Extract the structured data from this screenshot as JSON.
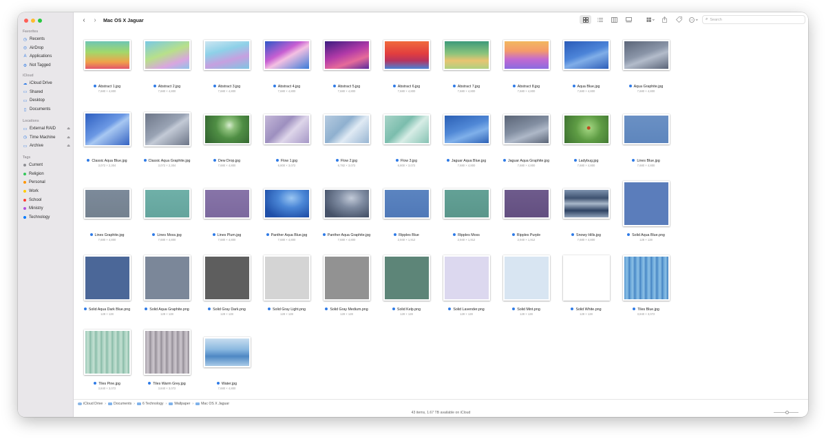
{
  "window": {
    "title": "Mac OS X Jaguar"
  },
  "toolbar": {
    "back_icon": "chevron-left-icon",
    "forward_icon": "chevron-right-icon",
    "view_buttons": [
      "icon-view",
      "list-view",
      "column-view",
      "gallery-view"
    ],
    "group_icon": "group-by-icon",
    "share_icon": "share-icon",
    "tag_icon": "tag-icon",
    "more_icon": "ellipsis-circle-icon",
    "search_placeholder": "Search"
  },
  "sidebar": {
    "sections": [
      {
        "heading": "Favorites",
        "items": [
          {
            "label": "Recents",
            "icon": "clock-icon"
          },
          {
            "label": "AirDrop",
            "icon": "airdrop-icon"
          },
          {
            "label": "Applications",
            "icon": "applications-icon"
          },
          {
            "label": "Not Tagged",
            "icon": "gear-icon"
          }
        ]
      },
      {
        "heading": "iCloud",
        "items": [
          {
            "label": "iCloud Drive",
            "icon": "cloud-icon"
          },
          {
            "label": "Shared",
            "icon": "shared-folder-icon"
          },
          {
            "label": "Desktop",
            "icon": "desktop-icon"
          },
          {
            "label": "Documents",
            "icon": "document-icon"
          }
        ]
      },
      {
        "heading": "Locations",
        "items": [
          {
            "label": "External RAID",
            "icon": "drive-icon",
            "eject": true
          },
          {
            "label": "Time Machine",
            "icon": "time-machine-icon",
            "eject": true
          },
          {
            "label": "Archive",
            "icon": "drive-icon",
            "eject": true
          }
        ]
      },
      {
        "heading": "Tags",
        "items": [
          {
            "label": "Current",
            "color": "#8e8e93"
          },
          {
            "label": "Religion",
            "color": "#34c759"
          },
          {
            "label": "Personal",
            "color": "#ff9500"
          },
          {
            "label": "Work",
            "color": "#ffcc00"
          },
          {
            "label": "School",
            "color": "#ff3b30"
          },
          {
            "label": "Ministry",
            "color": "#af52de"
          },
          {
            "label": "Technology",
            "color": "#007aff"
          }
        ]
      }
    ]
  },
  "files": [
    {
      "name": "Abstract 1.jpg",
      "dims": "7,680 × 4,800",
      "shape": "wide",
      "fill": "linear-gradient(180deg,#6fc6b4 0%,#a3d86a 40%,#f0a24a 75%,#e2556a 100%)"
    },
    {
      "name": "Abstract 2.jpg",
      "dims": "7,680 × 4,800",
      "shape": "wide",
      "fill": "linear-gradient(160deg,#79c9e6 0%,#b8e08a 45%,#d9a6e0 75%,#8fc3e8 100%)"
    },
    {
      "name": "Abstract 3.jpg",
      "dims": "7,680 × 4,800",
      "shape": "wide",
      "fill": "linear-gradient(165deg,#cde6f2 0%,#8ed1e8 35%,#c6a0e0 65%,#7ec6e2 100%)"
    },
    {
      "name": "Abstract 4.jpg",
      "dims": "7,680 × 4,800",
      "shape": "wide",
      "fill": "linear-gradient(150deg,#2d56c8 0%,#c75fd2 40%,#f4c0e2 55%,#3a7bd8 100%)"
    },
    {
      "name": "Abstract 5.jpg",
      "dims": "7,680 × 4,800",
      "shape": "wide",
      "fill": "linear-gradient(160deg,#3b1c80 0%,#b23aa8 45%,#e66b9a 70%,#5a2a9c 100%)"
    },
    {
      "name": "Abstract 6.jpg",
      "dims": "7,680 × 4,800",
      "shape": "wide",
      "fill": "linear-gradient(180deg,#f06a3c 0%,#e23e3e 45%,#b8345e 70%,#4a82d4 100%)"
    },
    {
      "name": "Abstract 7.jpg",
      "dims": "7,680 × 4,800",
      "shape": "wide",
      "fill": "linear-gradient(180deg,#3c9a7a 0%,#8cc47c 45%,#e8c472 70%,#b0d080 100%)"
    },
    {
      "name": "Abstract 8.jpg",
      "dims": "7,680 × 4,800",
      "shape": "wide",
      "fill": "linear-gradient(180deg,#f2b860 0%,#f49a6a 35%,#c36ad0 65%,#8b6be0 100%)"
    },
    {
      "name": "Aqua Blue.jpg",
      "dims": "7,680 × 4,800",
      "shape": "wide",
      "fill": "linear-gradient(160deg,#2a5bb8 0%,#4c84d8 45%,#80aee8 60%,#2d5eb8 100%)"
    },
    {
      "name": "Aqua Graphite.jpg",
      "dims": "7,680 × 4,800",
      "shape": "wide",
      "fill": "linear-gradient(160deg,#5b6578 0%,#8a95a8 45%,#b3bccb 60%,#5a6478 100%)"
    },
    {
      "name": "Classic Aqua Blue.jpg",
      "dims": "3,072 × 2,304",
      "shape": "wide-tall",
      "fill": "linear-gradient(145deg,#2e5fc0 0%,#6b98e4 45%,#a8c8f2 55%,#3563c2 100%)"
    },
    {
      "name": "Classic Aqua Graphite.jpg",
      "dims": "3,072 × 2,304",
      "shape": "wide-tall",
      "fill": "linear-gradient(145deg,#6d7688 0%,#99a3b4 45%,#c3cad6 55%,#6c7587 100%)"
    },
    {
      "name": "Dew Drop.jpg",
      "dims": "7,680 × 4,800",
      "shape": "wide",
      "fill": "radial-gradient(circle at 55% 35%,#d8ecd0 0%,#8cbf7a 18%,#4f8e44 45%,#2f5f2e 100%)"
    },
    {
      "name": "Flow 1.jpg",
      "dims": "6,800 × 3,072",
      "shape": "wide",
      "fill": "linear-gradient(135deg,#c4b8d8 0%,#9d8fbf 40%,#ded6ea 60%,#a597c6 100%)"
    },
    {
      "name": "Flow 2.jpg",
      "dims": "6,782 × 3,072",
      "shape": "wide",
      "fill": "linear-gradient(135deg,#b6cbe0 0%,#8fb0cf 40%,#e0eaf4 60%,#98b5d2 100%)"
    },
    {
      "name": "Flow 3.jpg",
      "dims": "6,800 × 3,072",
      "shape": "wide",
      "fill": "linear-gradient(135deg,#a8d4c8 0%,#7bbdad 40%,#d7ede6 60%,#86c2b3 100%)"
    },
    {
      "name": "Jaguar Aqua Blue.jpg",
      "dims": "7,680 × 4,800",
      "shape": "wide",
      "fill": "linear-gradient(160deg,#2b5fb4 0%,#5088d6 45%,#7fb0ea 65%,#2e62b6 100%)"
    },
    {
      "name": "Jaguar Aqua Graphite.jpg",
      "dims": "7,680 × 4,800",
      "shape": "wide",
      "fill": "linear-gradient(160deg,#5a6476 0%,#838fa2 45%,#aeb8c8 65%,#5b6577 100%)"
    },
    {
      "name": "Ladybug.jpg",
      "dims": "7,680 × 4,800",
      "shape": "wide",
      "fill": "radial-gradient(circle at 55% 45%,#c04a20 0%,#c04a20 5%,#9bcf7a 7%,#5e9c44 45%,#3c7030 100%)"
    },
    {
      "name": "Lines Blue.jpg",
      "dims": "7,680 × 4,800",
      "shape": "wide",
      "fill": "linear-gradient(180deg,#6a90c4 0%,#5e86bd 100%)"
    },
    {
      "name": "Lines Graphite.jpg",
      "dims": "7,680 × 4,800",
      "shape": "wide",
      "fill": "linear-gradient(180deg,#7c8a9a 0%,#74818f 100%)"
    },
    {
      "name": "Lines Moss.jpg",
      "dims": "7,680 × 4,800",
      "shape": "wide",
      "fill": "linear-gradient(180deg,#6fb0a8 0%,#64a49d 100%)"
    },
    {
      "name": "Lines Plum.jpg",
      "dims": "7,680 × 4,800",
      "shape": "wide",
      "fill": "linear-gradient(180deg,#8774a8 0%,#7c699e 100%)"
    },
    {
      "name": "Panther Aqua Blue.jpg",
      "dims": "7,680 × 4,800",
      "shape": "wide",
      "fill": "radial-gradient(ellipse at 60% 30%,#9ac6f2 0%,#4a86d6 35%,#1f4fa8 80%)"
    },
    {
      "name": "Panther Aqua Graphite.jpg",
      "dims": "7,680 × 4,800",
      "shape": "wide",
      "fill": "radial-gradient(ellipse at 60% 30%,#c2cad8 0%,#7d8aa0 35%,#465268 80%)"
    },
    {
      "name": "Ripples Blue",
      "dims": "2,940 × 1,912",
      "shape": "wide",
      "fill": "linear-gradient(180deg,#5b84c0 0%,#5079b8 100%)"
    },
    {
      "name": "Ripples Moss",
      "dims": "2,940 × 1,912",
      "shape": "wide",
      "fill": "linear-gradient(180deg,#63a196 0%,#5a968b 100%)"
    },
    {
      "name": "Ripples Purple",
      "dims": "2,940 × 1,912",
      "shape": "wide",
      "fill": "linear-gradient(180deg,#6e5b8c 0%,#634f80 100%)"
    },
    {
      "name": "Snowy Hills.jpg",
      "dims": "7,680 × 4,800",
      "shape": "wide",
      "fill": "linear-gradient(180deg,#7d92ae 0%,#3e5270 30%,#a9b8ca 50%,#2e4262 75%,#8ea0b8 100%)"
    },
    {
      "name": "Solid Aqua Blue.png",
      "dims": "128 × 128",
      "shape": "square",
      "fill": "#5b7dbb"
    },
    {
      "name": "Solid Aqua Dark Blue.png",
      "dims": "128 × 128",
      "shape": "square",
      "fill": "#4b6798"
    },
    {
      "name": "Solid Aqua Graphite.png",
      "dims": "128 × 128",
      "shape": "square",
      "fill": "#7b8799"
    },
    {
      "name": "Solid Gray Dark.png",
      "dims": "128 × 128",
      "shape": "square",
      "fill": "#5e5e5e"
    },
    {
      "name": "Solid Gray Light.png",
      "dims": "128 × 128",
      "shape": "square",
      "fill": "#d4d4d4"
    },
    {
      "name": "Solid Gray Medium.png",
      "dims": "128 × 128",
      "shape": "square",
      "fill": "#929292"
    },
    {
      "name": "Solid Kelp.png",
      "dims": "128 × 128",
      "shape": "square",
      "fill": "#5d8578"
    },
    {
      "name": "Solid Lavender.png",
      "dims": "128 × 128",
      "shape": "square",
      "fill": "#dcd8ef"
    },
    {
      "name": "Solid Mint.png",
      "dims": "128 × 128",
      "shape": "square",
      "fill": "#d8e5f2"
    },
    {
      "name": "Solid White.png",
      "dims": "128 × 128",
      "shape": "square",
      "fill": "#ffffff"
    },
    {
      "name": "Tiles Blue.jpg",
      "dims": "3,840 × 3,072",
      "shape": "square",
      "fill": "repeating-linear-gradient(90deg,#5a9ad2 0px,#8cc0e6 4px,#3f7fc0 8px),linear-gradient(#5a9ad2,#5a9ad2)"
    },
    {
      "name": "Tiles Pine.jpg",
      "dims": "3,840 × 3,072",
      "shape": "square",
      "fill": "repeating-linear-gradient(90deg,#9ccab8 0px,#c4e0d2 4px,#84b8a4 8px)"
    },
    {
      "name": "Tiles Warm Grey.jpg",
      "dims": "3,840 × 3,072",
      "shape": "square",
      "fill": "repeating-linear-gradient(90deg,#a8a2aa 0px,#cdc7ce 4px,#8f8992 8px)"
    },
    {
      "name": "Water.jpg",
      "dims": "7,680 × 4,800",
      "shape": "wide",
      "fill": "linear-gradient(180deg,#c8ddf0 0%,#8ab8e0 40%,#4e88c4 65%,#aacbe8 100%)"
    }
  ],
  "pathbar": [
    {
      "label": "iCloud Drive",
      "icon": "cloud-icon"
    },
    {
      "label": "Documents",
      "icon": "folder-icon"
    },
    {
      "label": "6 Technology",
      "icon": "folder-icon"
    },
    {
      "label": "Wallpaper",
      "icon": "folder-icon"
    },
    {
      "label": "Mac OS X Jaguar",
      "icon": "folder-icon"
    }
  ],
  "status": {
    "text": "43 items, 1.67 TB available on iCloud",
    "zoom_level": 0.55
  }
}
